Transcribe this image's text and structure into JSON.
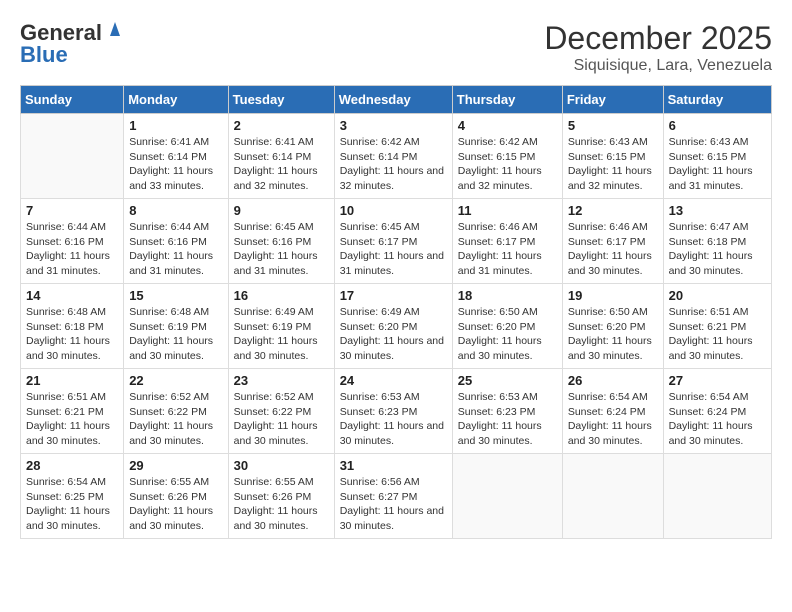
{
  "header": {
    "logo_line1": "General",
    "logo_line2": "Blue",
    "month": "December 2025",
    "location": "Siquisique, Lara, Venezuela"
  },
  "columns": [
    "Sunday",
    "Monday",
    "Tuesday",
    "Wednesday",
    "Thursday",
    "Friday",
    "Saturday"
  ],
  "weeks": [
    [
      {
        "day": "",
        "sunrise": "",
        "sunset": "",
        "daylight": ""
      },
      {
        "day": "1",
        "sunrise": "Sunrise: 6:41 AM",
        "sunset": "Sunset: 6:14 PM",
        "daylight": "Daylight: 11 hours and 33 minutes."
      },
      {
        "day": "2",
        "sunrise": "Sunrise: 6:41 AM",
        "sunset": "Sunset: 6:14 PM",
        "daylight": "Daylight: 11 hours and 32 minutes."
      },
      {
        "day": "3",
        "sunrise": "Sunrise: 6:42 AM",
        "sunset": "Sunset: 6:14 PM",
        "daylight": "Daylight: 11 hours and 32 minutes."
      },
      {
        "day": "4",
        "sunrise": "Sunrise: 6:42 AM",
        "sunset": "Sunset: 6:15 PM",
        "daylight": "Daylight: 11 hours and 32 minutes."
      },
      {
        "day": "5",
        "sunrise": "Sunrise: 6:43 AM",
        "sunset": "Sunset: 6:15 PM",
        "daylight": "Daylight: 11 hours and 32 minutes."
      },
      {
        "day": "6",
        "sunrise": "Sunrise: 6:43 AM",
        "sunset": "Sunset: 6:15 PM",
        "daylight": "Daylight: 11 hours and 31 minutes."
      }
    ],
    [
      {
        "day": "7",
        "sunrise": "Sunrise: 6:44 AM",
        "sunset": "Sunset: 6:16 PM",
        "daylight": "Daylight: 11 hours and 31 minutes."
      },
      {
        "day": "8",
        "sunrise": "Sunrise: 6:44 AM",
        "sunset": "Sunset: 6:16 PM",
        "daylight": "Daylight: 11 hours and 31 minutes."
      },
      {
        "day": "9",
        "sunrise": "Sunrise: 6:45 AM",
        "sunset": "Sunset: 6:16 PM",
        "daylight": "Daylight: 11 hours and 31 minutes."
      },
      {
        "day": "10",
        "sunrise": "Sunrise: 6:45 AM",
        "sunset": "Sunset: 6:17 PM",
        "daylight": "Daylight: 11 hours and 31 minutes."
      },
      {
        "day": "11",
        "sunrise": "Sunrise: 6:46 AM",
        "sunset": "Sunset: 6:17 PM",
        "daylight": "Daylight: 11 hours and 31 minutes."
      },
      {
        "day": "12",
        "sunrise": "Sunrise: 6:46 AM",
        "sunset": "Sunset: 6:17 PM",
        "daylight": "Daylight: 11 hours and 30 minutes."
      },
      {
        "day": "13",
        "sunrise": "Sunrise: 6:47 AM",
        "sunset": "Sunset: 6:18 PM",
        "daylight": "Daylight: 11 hours and 30 minutes."
      }
    ],
    [
      {
        "day": "14",
        "sunrise": "Sunrise: 6:48 AM",
        "sunset": "Sunset: 6:18 PM",
        "daylight": "Daylight: 11 hours and 30 minutes."
      },
      {
        "day": "15",
        "sunrise": "Sunrise: 6:48 AM",
        "sunset": "Sunset: 6:19 PM",
        "daylight": "Daylight: 11 hours and 30 minutes."
      },
      {
        "day": "16",
        "sunrise": "Sunrise: 6:49 AM",
        "sunset": "Sunset: 6:19 PM",
        "daylight": "Daylight: 11 hours and 30 minutes."
      },
      {
        "day": "17",
        "sunrise": "Sunrise: 6:49 AM",
        "sunset": "Sunset: 6:20 PM",
        "daylight": "Daylight: 11 hours and 30 minutes."
      },
      {
        "day": "18",
        "sunrise": "Sunrise: 6:50 AM",
        "sunset": "Sunset: 6:20 PM",
        "daylight": "Daylight: 11 hours and 30 minutes."
      },
      {
        "day": "19",
        "sunrise": "Sunrise: 6:50 AM",
        "sunset": "Sunset: 6:20 PM",
        "daylight": "Daylight: 11 hours and 30 minutes."
      },
      {
        "day": "20",
        "sunrise": "Sunrise: 6:51 AM",
        "sunset": "Sunset: 6:21 PM",
        "daylight": "Daylight: 11 hours and 30 minutes."
      }
    ],
    [
      {
        "day": "21",
        "sunrise": "Sunrise: 6:51 AM",
        "sunset": "Sunset: 6:21 PM",
        "daylight": "Daylight: 11 hours and 30 minutes."
      },
      {
        "day": "22",
        "sunrise": "Sunrise: 6:52 AM",
        "sunset": "Sunset: 6:22 PM",
        "daylight": "Daylight: 11 hours and 30 minutes."
      },
      {
        "day": "23",
        "sunrise": "Sunrise: 6:52 AM",
        "sunset": "Sunset: 6:22 PM",
        "daylight": "Daylight: 11 hours and 30 minutes."
      },
      {
        "day": "24",
        "sunrise": "Sunrise: 6:53 AM",
        "sunset": "Sunset: 6:23 PM",
        "daylight": "Daylight: 11 hours and 30 minutes."
      },
      {
        "day": "25",
        "sunrise": "Sunrise: 6:53 AM",
        "sunset": "Sunset: 6:23 PM",
        "daylight": "Daylight: 11 hours and 30 minutes."
      },
      {
        "day": "26",
        "sunrise": "Sunrise: 6:54 AM",
        "sunset": "Sunset: 6:24 PM",
        "daylight": "Daylight: 11 hours and 30 minutes."
      },
      {
        "day": "27",
        "sunrise": "Sunrise: 6:54 AM",
        "sunset": "Sunset: 6:24 PM",
        "daylight": "Daylight: 11 hours and 30 minutes."
      }
    ],
    [
      {
        "day": "28",
        "sunrise": "Sunrise: 6:54 AM",
        "sunset": "Sunset: 6:25 PM",
        "daylight": "Daylight: 11 hours and 30 minutes."
      },
      {
        "day": "29",
        "sunrise": "Sunrise: 6:55 AM",
        "sunset": "Sunset: 6:26 PM",
        "daylight": "Daylight: 11 hours and 30 minutes."
      },
      {
        "day": "30",
        "sunrise": "Sunrise: 6:55 AM",
        "sunset": "Sunset: 6:26 PM",
        "daylight": "Daylight: 11 hours and 30 minutes."
      },
      {
        "day": "31",
        "sunrise": "Sunrise: 6:56 AM",
        "sunset": "Sunset: 6:27 PM",
        "daylight": "Daylight: 11 hours and 30 minutes."
      },
      {
        "day": "",
        "sunrise": "",
        "sunset": "",
        "daylight": ""
      },
      {
        "day": "",
        "sunrise": "",
        "sunset": "",
        "daylight": ""
      },
      {
        "day": "",
        "sunrise": "",
        "sunset": "",
        "daylight": ""
      }
    ]
  ]
}
